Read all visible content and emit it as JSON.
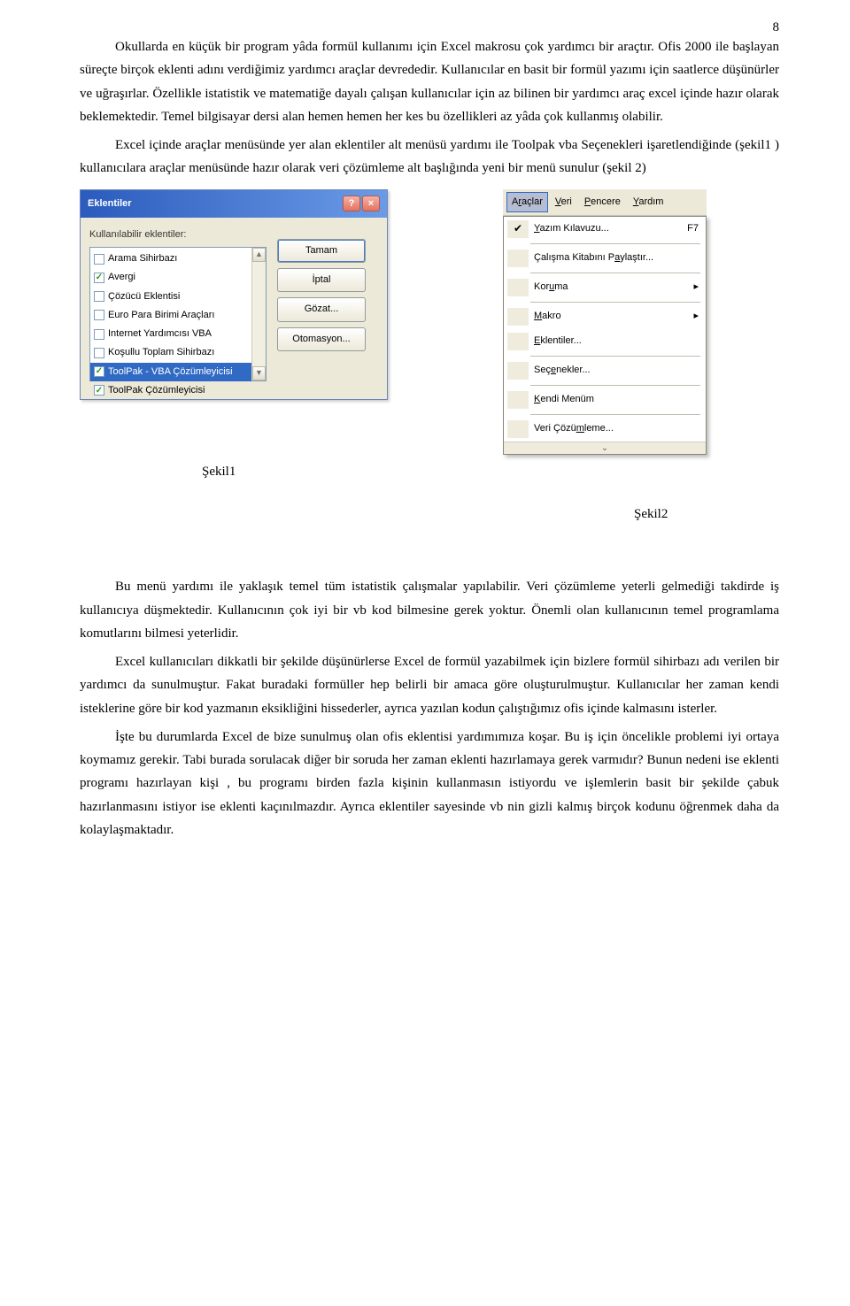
{
  "page_number": "8",
  "para1": "Okullarda en küçük bir program yâda formül kullanımı için Excel makrosu çok yardımcı bir araçtır. Ofis 2000 ile başlayan süreçte birçok eklenti adını verdiğimiz yardımcı araçlar devrededir. Kullanıcılar en basit bir formül yazımı için saatlerce düşünürler ve uğraşırlar. Özellikle istatistik ve matematiğe dayalı çalışan kullanıcılar için az bilinen bir yardımcı araç excel içinde hazır olarak beklemektedir. Temel bilgisayar dersi alan hemen hemen her kes bu özellikleri az yâda çok kullanmış olabilir.",
  "para2": "Excel içinde araçlar menüsünde yer alan eklentiler alt menüsü yardımı ile Toolpak vba Seçenekleri işaretlendiğinde (şekil1 ) kullanıcılara araçlar menüsünde hazır olarak veri çözümleme alt başlığında yeni bir menü sunulur (şekil 2)",
  "para3": "Bu menü yardımı ile yaklaşık temel tüm istatistik çalışmalar yapılabilir. Veri çözümleme yeterli gelmediği takdirde iş kullanıcıya düşmektedir. Kullanıcının çok iyi bir vb kod bilmesine gerek yoktur. Önemli olan kullanıcının temel programlama komutlarını bilmesi yeterlidir.",
  "para4": "Excel kullanıcıları dikkatli bir şekilde düşünürlerse Excel de formül yazabilmek için bizlere formül sihirbazı adı verilen bir yardımcı da sunulmuştur. Fakat buradaki formüller hep belirli bir amaca göre oluşturulmuştur. Kullanıcılar her zaman kendi isteklerine göre bir kod yazmanın eksikliğini hissederler, ayrıca yazılan kodun çalıştığımız ofis içinde kalmasını isterler.",
  "para5": "İşte bu durumlarda Excel de bize sunulmuş olan ofis eklentisi yardımımıza koşar. Bu iş için öncelikle problemi iyi ortaya koymamız gerekir. Tabi burada sorulacak diğer bir soruda her zaman eklenti hazırlamaya gerek varmıdır? Bunun nedeni ise eklenti programı hazırlayan kişi , bu programı birden fazla kişinin kullanmasın istiyordu ve işlemlerin basit bir şekilde çabuk hazırlanmasını istiyor ise eklenti kaçınılmazdır. Ayrıca eklentiler sayesinde vb nin gizli kalmış birçok kodunu öğrenmek daha da kolaylaşmaktadır.",
  "fig1": {
    "caption": "Şekil1",
    "title": "Eklentiler",
    "help": "?",
    "close": "×",
    "label": "Kullanılabilir eklentiler:",
    "items": [
      {
        "label": "Arama Sihirbazı",
        "checked": false
      },
      {
        "label": "Avergi",
        "checked": true
      },
      {
        "label": "Çözücü Eklentisi",
        "checked": false
      },
      {
        "label": "Euro Para Birimi Araçları",
        "checked": false
      },
      {
        "label": "Internet Yardımcısı VBA",
        "checked": false
      },
      {
        "label": "Koşullu Toplam Sihirbazı",
        "checked": false
      },
      {
        "label": "ToolPak - VBA Çözümleyicisi",
        "checked": true
      },
      {
        "label": "ToolPak Çözümleyicisi",
        "checked": true
      }
    ],
    "buttons": {
      "ok": "Tamam",
      "cancel": "İptal",
      "browse": "Gözat...",
      "automation": "Otomasyon..."
    }
  },
  "fig2": {
    "caption": "Şekil2",
    "menubar": {
      "tools_pre": "A",
      "tools_u": "r",
      "tools_post": "açlar",
      "data_pre": "",
      "data_u": "V",
      "data_post": "eri",
      "window_pre": "",
      "window_u": "P",
      "window_post": "encere",
      "help_pre": "",
      "help_u": "Y",
      "help_post": "ardım"
    },
    "rows": {
      "spell_pre": "",
      "spell_u": "Y",
      "spell_post": "azım Kılavuzu...",
      "spell_sc": "F7",
      "share_pre": "Çalışma Kitabını P",
      "share_u": "a",
      "share_post": "ylaştır...",
      "protect_pre": "Kor",
      "protect_u": "u",
      "protect_post": "ma",
      "macro_pre": "",
      "macro_u": "M",
      "macro_post": "akro",
      "addins_pre": "",
      "addins_u": "E",
      "addins_post": "klentiler...",
      "options_pre": "Seç",
      "options_u": "e",
      "options_post": "nekler...",
      "mymenu_pre": "",
      "mymenu_u": "K",
      "mymenu_post": "endi Menüm",
      "dataan_pre": "Veri Çözü",
      "dataan_u": "m",
      "dataan_post": "leme..."
    }
  }
}
